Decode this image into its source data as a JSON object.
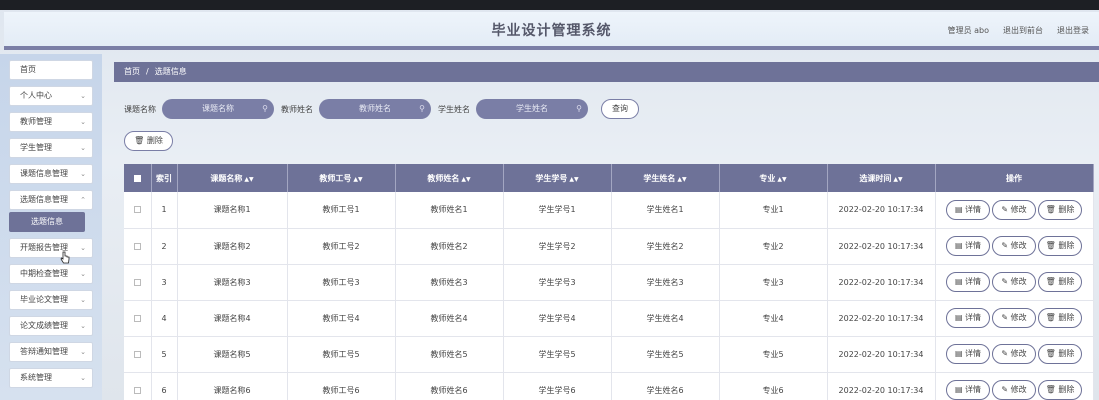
{
  "header": {
    "title": "毕业设计管理系统",
    "user": "管理员 abo",
    "front_link": "退出到前台",
    "logout": "退出登录"
  },
  "sidebar": {
    "items": [
      {
        "label": "首页"
      },
      {
        "label": "个人中心"
      },
      {
        "label": "教师管理"
      },
      {
        "label": "学生管理"
      },
      {
        "label": "课题信息管理"
      },
      {
        "label": "选题信息管理"
      },
      {
        "label": "开题报告管理"
      },
      {
        "label": "中期检查管理"
      },
      {
        "label": "毕业论文管理"
      },
      {
        "label": "论文成绩管理"
      },
      {
        "label": "答辩通知管理"
      },
      {
        "label": "系统管理"
      }
    ],
    "sub_item": "选题信息"
  },
  "breadcrumb": {
    "home": "首页",
    "sep": "/",
    "current": "选题信息"
  },
  "search": {
    "topic_label": "课题名称",
    "topic_placeholder": "课题名称",
    "teacher_label": "教师姓名",
    "teacher_placeholder": "教师姓名",
    "student_label": "学生姓名",
    "student_placeholder": "学生姓名",
    "query_button": "查询"
  },
  "actions": {
    "delete_button": "删除"
  },
  "table": {
    "headers": [
      "索引",
      "课题名称",
      "教师工号",
      "教师姓名",
      "学生学号",
      "学生姓名",
      "专业",
      "选课时间",
      "操作"
    ],
    "rows": [
      {
        "idx": "1",
        "topic": "课题名称1",
        "tid": "教师工号1",
        "tname": "教师姓名1",
        "sid": "学生学号1",
        "sname": "学生姓名1",
        "major": "专业1",
        "time": "2022-02-20 10:17:34"
      },
      {
        "idx": "2",
        "topic": "课题名称2",
        "tid": "教师工号2",
        "tname": "教师姓名2",
        "sid": "学生学号2",
        "sname": "学生姓名2",
        "major": "专业2",
        "time": "2022-02-20 10:17:34"
      },
      {
        "idx": "3",
        "topic": "课题名称3",
        "tid": "教师工号3",
        "tname": "教师姓名3",
        "sid": "学生学号3",
        "sname": "学生姓名3",
        "major": "专业3",
        "time": "2022-02-20 10:17:34"
      },
      {
        "idx": "4",
        "topic": "课题名称4",
        "tid": "教师工号4",
        "tname": "教师姓名4",
        "sid": "学生学号4",
        "sname": "学生姓名4",
        "major": "专业4",
        "time": "2022-02-20 10:17:34"
      },
      {
        "idx": "5",
        "topic": "课题名称5",
        "tid": "教师工号5",
        "tname": "教师姓名5",
        "sid": "学生学号5",
        "sname": "学生姓名5",
        "major": "专业5",
        "time": "2022-02-20 10:17:34"
      },
      {
        "idx": "6",
        "topic": "课题名称6",
        "tid": "教师工号6",
        "tname": "教师姓名6",
        "sid": "学生学号6",
        "sname": "学生姓名6",
        "major": "专业6",
        "time": "2022-02-20 10:17:34"
      }
    ],
    "row_actions": {
      "detail": "详情",
      "edit": "修改",
      "delete": "删除"
    }
  }
}
